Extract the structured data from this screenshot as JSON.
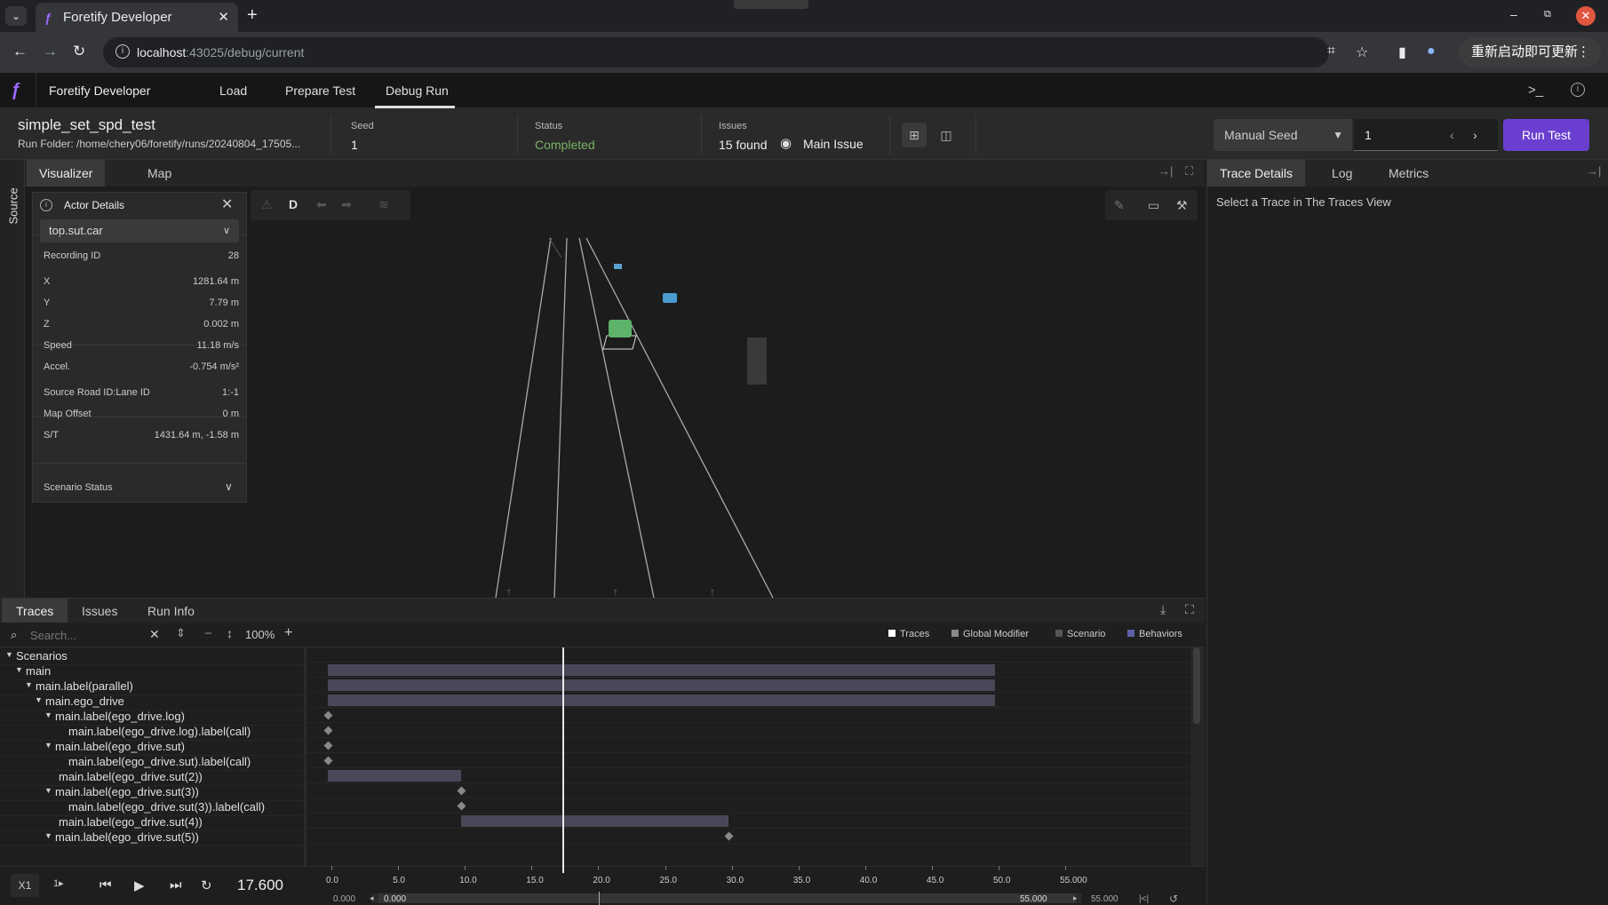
{
  "browser": {
    "tab_title": "Foretify Developer",
    "url_host": "localhost",
    "url_path": ":43025/debug/current",
    "update_button": "重新启动即可更新"
  },
  "app": {
    "name": "Foretify Developer",
    "nav": [
      "Load",
      "Prepare Test",
      "Debug Run"
    ],
    "active_nav": "Debug Run"
  },
  "run": {
    "title": "simple_set_spd_test",
    "folder": "Run Folder: /home/chery06/foretify/runs/20240804_17505...",
    "seed_label": "Seed",
    "seed_value": "1",
    "status_label": "Status",
    "status_value": "Completed",
    "status_color": "#79b266",
    "issues_label": "Issues",
    "issues_value": "15 found",
    "main_issue": "Main Issue",
    "seed_mode": "Manual Seed",
    "seed_input": "1",
    "run_button": "Run Test",
    "accent_color": "#6a3fd0"
  },
  "left_strip": {
    "label": "Source"
  },
  "visualizer": {
    "tabs": [
      "Visualizer",
      "Map"
    ],
    "toolbar_mode": "D"
  },
  "actor": {
    "title": "Actor Details",
    "selected": "top.sut.car",
    "props": [
      {
        "k": "Recording ID",
        "v": "28"
      },
      {
        "k": "X",
        "v": "1281.64 m"
      },
      {
        "k": "Y",
        "v": "7.79 m"
      },
      {
        "k": "Z",
        "v": "0.002 m"
      },
      {
        "k": "Speed",
        "v": "11.18 m/s"
      },
      {
        "k": "Accel.",
        "v": "-0.754 m/s²"
      },
      {
        "k": "Source Road ID:Lane ID",
        "v": "1:-1"
      },
      {
        "k": "Map Offset",
        "v": "0 m"
      },
      {
        "k": "S/T",
        "v": "1431.64 m, -1.58 m"
      }
    ],
    "scenario_status": "Scenario Status"
  },
  "right_panel": {
    "tabs": [
      "Trace Details",
      "Log",
      "Metrics"
    ],
    "hint": "Select a Trace in The Traces View"
  },
  "bottom": {
    "tabs": [
      "Traces",
      "Issues",
      "Run Info"
    ],
    "search_placeholder": "Search...",
    "zoom": "100%",
    "legend": [
      {
        "label": "Traces",
        "color": "#ffffff"
      },
      {
        "label": "Global Modifier",
        "color": "#8a8a8a"
      },
      {
        "label": "Scenario",
        "color": "#555555"
      },
      {
        "label": "Behaviors",
        "color": "#5e60a8"
      }
    ],
    "tree": [
      {
        "label": "Scenarios",
        "indent": 0,
        "toggle": true
      },
      {
        "label": "main",
        "indent": 1,
        "toggle": true
      },
      {
        "label": "main.label(parallel)",
        "indent": 2,
        "toggle": true
      },
      {
        "label": "main.ego_drive",
        "indent": 3,
        "toggle": true
      },
      {
        "label": "main.label(ego_drive.log)",
        "indent": 4,
        "toggle": true
      },
      {
        "label": "main.label(ego_drive.log).label(call)",
        "indent": 5,
        "toggle": false
      },
      {
        "label": "main.label(ego_drive.sut)",
        "indent": 4,
        "toggle": true
      },
      {
        "label": "main.label(ego_drive.sut).label(call)",
        "indent": 5,
        "toggle": false
      },
      {
        "label": "main.label(ego_drive.sut(2))",
        "indent": 4,
        "toggle": false
      },
      {
        "label": "main.label(ego_drive.sut(3))",
        "indent": 4,
        "toggle": true
      },
      {
        "label": "main.label(ego_drive.sut(3)).label(call)",
        "indent": 5,
        "toggle": false
      },
      {
        "label": "main.label(ego_drive.sut(4))",
        "indent": 4,
        "toggle": false
      },
      {
        "label": "main.label(ego_drive.sut(5))",
        "indent": 4,
        "toggle": true
      }
    ],
    "timeline_rows": [
      {
        "type": "none"
      },
      {
        "type": "bar",
        "start": 0.0,
        "end": 50.0
      },
      {
        "type": "bar",
        "start": 0.0,
        "end": 50.0
      },
      {
        "type": "bar",
        "start": 0.0,
        "end": 50.0
      },
      {
        "type": "diamond",
        "at": 0.0
      },
      {
        "type": "diamond",
        "at": 0.0
      },
      {
        "type": "diamond",
        "at": 0.0
      },
      {
        "type": "diamond",
        "at": 0.0
      },
      {
        "type": "bar",
        "start": 0.0,
        "end": 10.0
      },
      {
        "type": "diamond",
        "at": 10.0
      },
      {
        "type": "diamond",
        "at": 10.0
      },
      {
        "type": "bar",
        "start": 10.0,
        "end": 30.0
      },
      {
        "type": "diamond",
        "at": 30.0
      }
    ],
    "axis_ticks": [
      "0.0",
      "5.0",
      "10.0",
      "15.0",
      "20.0",
      "25.0",
      "30.0",
      "35.0",
      "40.0",
      "45.0",
      "50.0",
      "55.000"
    ],
    "axis_max": 55.0,
    "current_time": 17.6,
    "range_start_outer": "0.000",
    "range_start": "0.000",
    "range_end": "55.000",
    "range_end_outer": "55.000"
  },
  "playback": {
    "speed": "X1",
    "step": "1▸",
    "time": "17.600"
  }
}
